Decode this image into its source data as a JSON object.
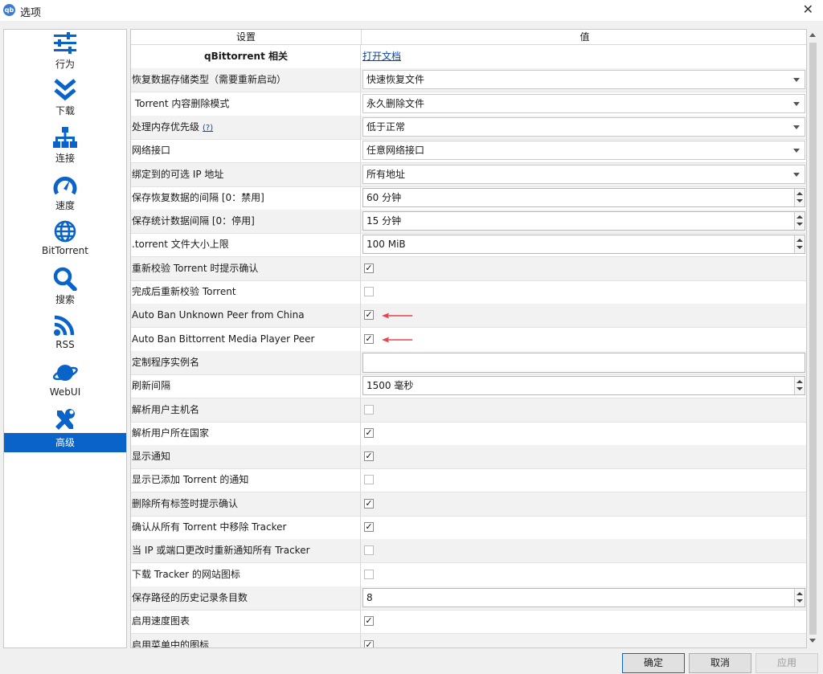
{
  "window": {
    "title": "选项",
    "app_icon_text": "qb"
  },
  "sidebar": {
    "items": [
      {
        "label": "行为",
        "icon": "sliders-icon"
      },
      {
        "label": "下载",
        "icon": "double-chevron-down-icon"
      },
      {
        "label": "连接",
        "icon": "network-icon"
      },
      {
        "label": "速度",
        "icon": "speedometer-icon"
      },
      {
        "label": "BitTorrent",
        "icon": "globe-icon"
      },
      {
        "label": "搜索",
        "icon": "search-icon"
      },
      {
        "label": "RSS",
        "icon": "rss-icon"
      },
      {
        "label": "WebUI",
        "icon": "planet-icon"
      },
      {
        "label": "高级",
        "icon": "tools-icon",
        "active": true
      }
    ]
  },
  "table": {
    "headers": [
      "设置",
      "值"
    ],
    "rows": [
      {
        "label": "qBittorrent 相关",
        "type": "link",
        "value": "打开文档"
      },
      {
        "label": "恢复数据存储类型（需要重新启动）",
        "type": "combo",
        "value": "快速恢复文件"
      },
      {
        "label": " Torrent 内容删除模式",
        "type": "combo",
        "value": "永久删除文件"
      },
      {
        "label": "处理内存优先级",
        "help": "(?)",
        "type": "combo",
        "value": "低于正常"
      },
      {
        "label": "网络接口",
        "type": "combo",
        "value": "任意网络接口"
      },
      {
        "label": "绑定到的可选 IP 地址",
        "type": "combo",
        "value": "所有地址"
      },
      {
        "label": "保存恢复数据的间隔 [0：禁用]",
        "type": "spin",
        "value": "60 分钟"
      },
      {
        "label": "保存统计数据间隔 [0：停用]",
        "type": "spin",
        "value": "15 分钟"
      },
      {
        "label": ".torrent 文件大小上限",
        "type": "spin",
        "value": "100 MiB"
      },
      {
        "label": "重新校验 Torrent 时提示确认",
        "type": "check",
        "checked": true
      },
      {
        "label": "完成后重新校验 Torrent",
        "type": "check",
        "checked": false
      },
      {
        "label": "Auto Ban Unknown Peer from China",
        "type": "check",
        "checked": true,
        "annotated": true
      },
      {
        "label": "Auto Ban Bittorrent Media Player Peer",
        "type": "check",
        "checked": true,
        "annotated": true
      },
      {
        "label": "定制程序实例名",
        "type": "text",
        "value": ""
      },
      {
        "label": "刷新间隔",
        "type": "spin",
        "value": "1500 毫秒"
      },
      {
        "label": "解析用户主机名",
        "type": "check",
        "checked": false
      },
      {
        "label": "解析用户所在国家",
        "type": "check",
        "checked": true
      },
      {
        "label": "显示通知",
        "type": "check",
        "checked": true
      },
      {
        "label": "显示已添加 Torrent 的通知",
        "type": "check",
        "checked": false
      },
      {
        "label": "删除所有标签时提示确认",
        "type": "check",
        "checked": true
      },
      {
        "label": "确认从所有 Torrent 中移除 Tracker",
        "type": "check",
        "checked": true
      },
      {
        "label": "当 IP 或端口更改时重新通知所有 Tracker",
        "type": "check",
        "checked": false
      },
      {
        "label": "下载 Tracker 的网站图标",
        "type": "check",
        "checked": false
      },
      {
        "label": "保存路径的历史记录条目数",
        "type": "spin",
        "value": "8"
      },
      {
        "label": "启用速度图表",
        "type": "check",
        "checked": true
      },
      {
        "label": "启用菜单中的图标",
        "type": "check",
        "checked": true
      }
    ],
    "check_mark": "✓"
  },
  "buttons": {
    "ok": "确定",
    "cancel": "取消",
    "apply": "应用"
  },
  "colors": {
    "accent": "#0a63c9",
    "icon": "#0a63c9",
    "annotation_arrow": "#e8434f"
  }
}
